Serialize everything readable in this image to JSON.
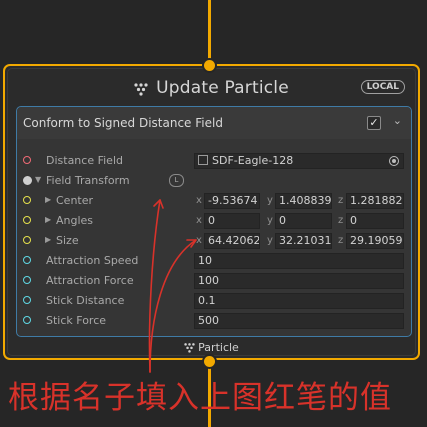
{
  "node": {
    "title": "Update Particle",
    "badge": "LOCAL",
    "footer": "Particle"
  },
  "block": {
    "title": "Conform to Signed Distance Field",
    "checked": "✓",
    "chevron": "⌄"
  },
  "rows": {
    "distance_field": {
      "label": "Distance Field",
      "value": "SDF-Eagle-128"
    },
    "field_transform": {
      "label": "Field Transform",
      "space": "L"
    },
    "center": {
      "label": "Center",
      "x": "-9.53674",
      "y": "1.408839",
      "z": "1.281882"
    },
    "angles": {
      "label": "Angles",
      "x": "0",
      "y": "0",
      "z": "0"
    },
    "size": {
      "label": "Size",
      "x": "64.42062",
      "y": "32.21031",
      "z": "29.19059"
    },
    "attraction_speed": {
      "label": "Attraction Speed",
      "value": "10"
    },
    "attraction_force": {
      "label": "Attraction Force",
      "value": "100"
    },
    "stick_distance": {
      "label": "Stick Distance",
      "value": "0.1"
    },
    "stick_force": {
      "label": "Stick Force",
      "value": "500"
    }
  },
  "axes": {
    "x": "x",
    "y": "y",
    "z": "z"
  },
  "annotation": "根据名子填入上图红笔的值",
  "colors": {
    "flow": "#f2a900",
    "block_border": "#3f7ba6",
    "annotation": "#d8322a",
    "port_red": "#f06a75",
    "port_yellow": "#e6e14c",
    "port_cyan": "#5fd8e5"
  }
}
